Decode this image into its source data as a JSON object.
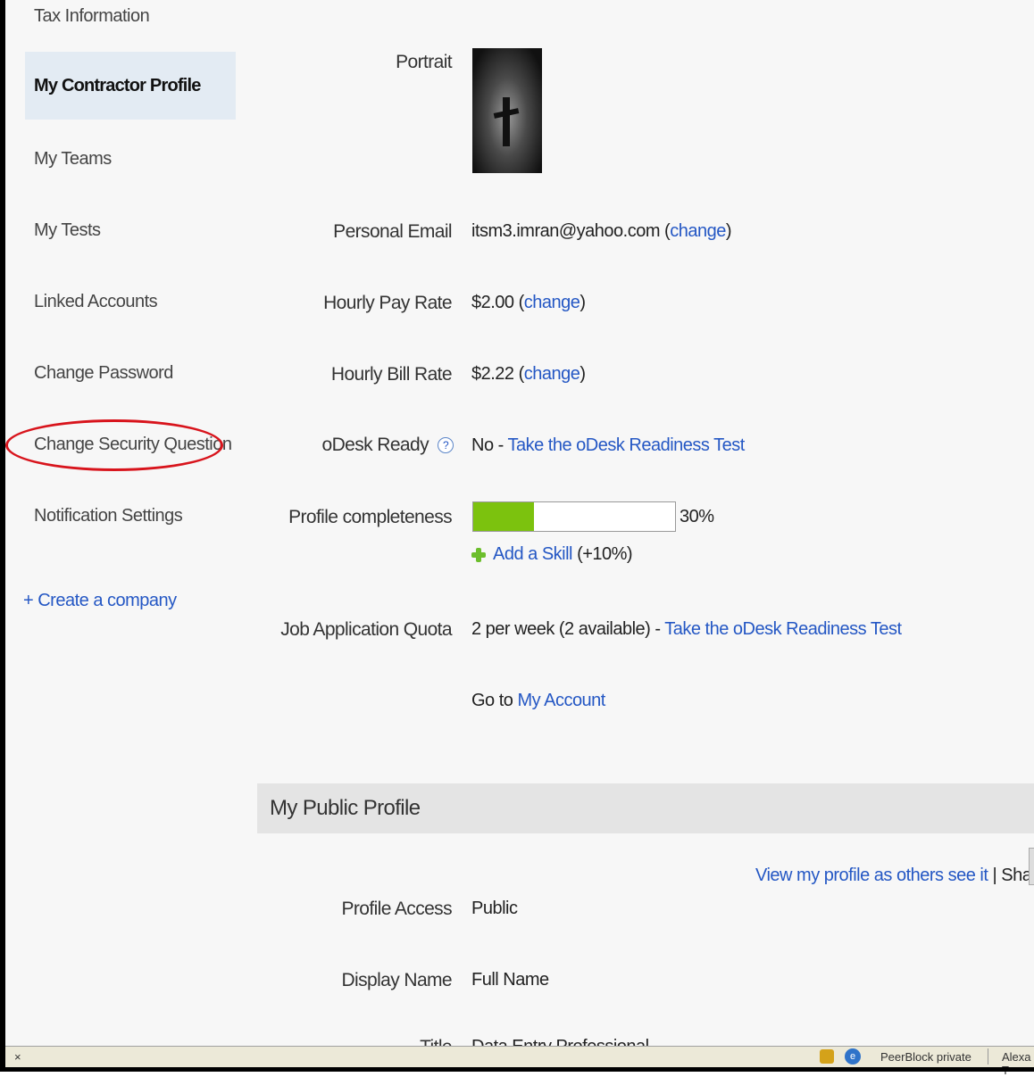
{
  "sidebar": {
    "items": [
      {
        "label": "Tax Information"
      },
      {
        "label": "My Contractor Profile"
      },
      {
        "label": "My Teams"
      },
      {
        "label": "My Tests"
      },
      {
        "label": "Linked Accounts"
      },
      {
        "label": "Change Password"
      },
      {
        "label": "Change Security Question"
      },
      {
        "label": "Notification Settings"
      }
    ],
    "create_company": "+ Create a company"
  },
  "profile": {
    "portrait_label": "Portrait",
    "email_label": "Personal Email",
    "email_value": "itsm3.imran@yahoo.com",
    "change_link": "change",
    "pay_label": "Hourly Pay Rate",
    "pay_value": "$2.00",
    "bill_label": "Hourly Bill Rate",
    "bill_value": "$2.22",
    "ready_label": "oDesk Ready",
    "ready_value": "No - ",
    "readiness_link": "Take the oDesk Readiness Test",
    "completeness_label": "Profile completeness",
    "completeness_percent": 30,
    "completeness_text": "30%",
    "add_skill_link": "Add a Skill",
    "add_skill_bonus": "(+10%)",
    "quota_label": "Job Application Quota",
    "quota_value": "2 per week (2 available) - ",
    "goto_text": "Go to ",
    "my_account_link": "My Account"
  },
  "public_profile": {
    "section_title": "My Public Profile",
    "view_link": "View my profile as others see it",
    "share_text": " | Share on",
    "access_label": "Profile Access",
    "access_value": "Public",
    "display_label": "Display Name",
    "display_value": "Full Name",
    "title_label": "Title",
    "title_value": "Data Entry Professional"
  },
  "statusbar": {
    "close_glyph": "×",
    "text1": "PeerBlock private",
    "text2": "Alexa T"
  },
  "colors": {
    "link": "#2457c4",
    "progress_fill": "#7cc20e",
    "highlight": "#d8141c"
  }
}
